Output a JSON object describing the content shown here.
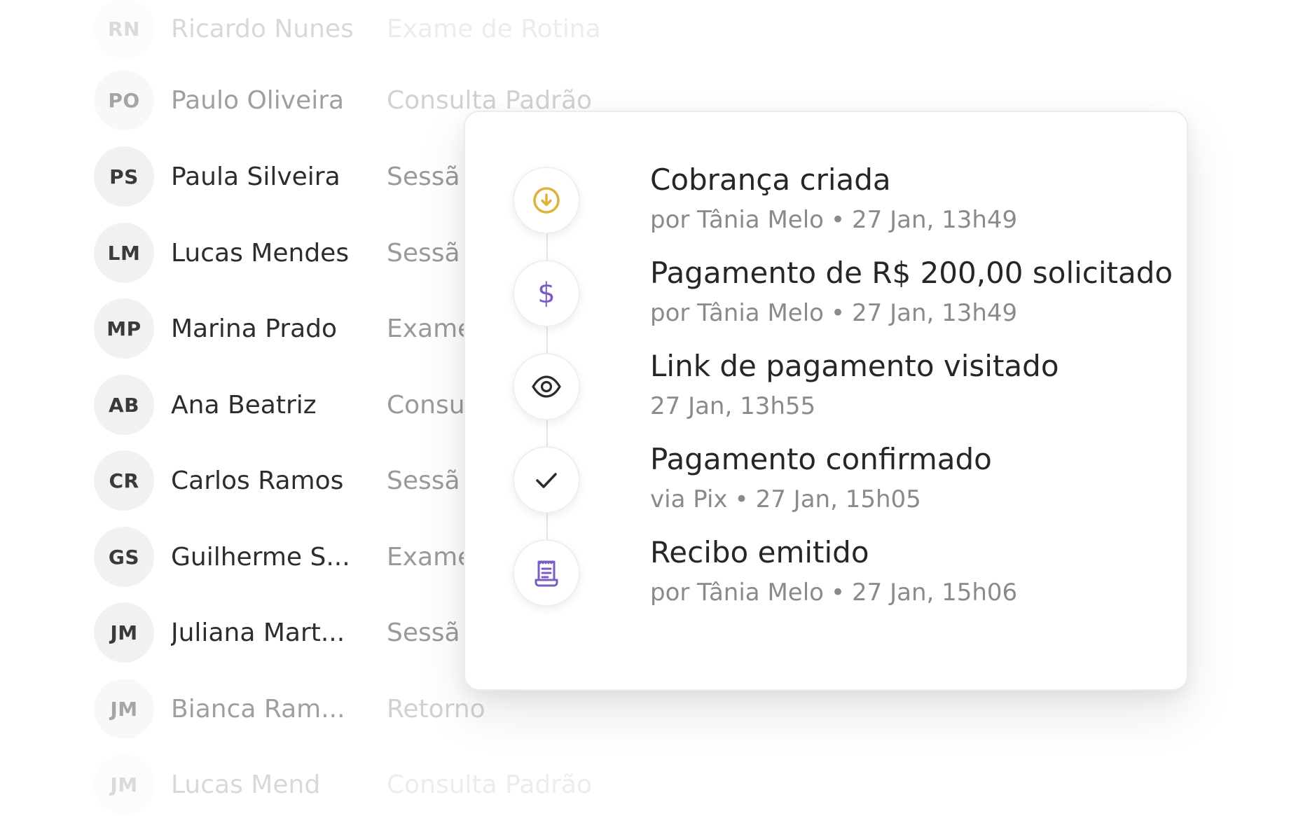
{
  "patients": [
    {
      "initials": "RN",
      "name": "Ricardo Nunes",
      "type": "Exame de Rotina"
    },
    {
      "initials": "PO",
      "name": "Paulo Oliveira",
      "type": "Consulta Padrão"
    },
    {
      "initials": "PS",
      "name": "Paula Silveira",
      "type": "Sessã"
    },
    {
      "initials": "LM",
      "name": "Lucas Mendes",
      "type": "Sessã"
    },
    {
      "initials": "MP",
      "name": "Marina Prado",
      "type": "Exame"
    },
    {
      "initials": "AB",
      "name": "Ana Beatriz",
      "type": "Consu"
    },
    {
      "initials": "CR",
      "name": "Carlos Ramos",
      "type": "Sessã"
    },
    {
      "initials": "GS",
      "name": "Guilherme S...",
      "type": "Exame"
    },
    {
      "initials": "JM",
      "name": "Juliana Mart...",
      "type": "Sessã"
    },
    {
      "initials": "JM",
      "name": "Bianca Ram...",
      "type": "Retorno"
    },
    {
      "initials": "JM",
      "name": "Lucas Mend",
      "type": "Consulta Padrão"
    }
  ],
  "timeline": {
    "events": [
      {
        "title": "Cobrança criada",
        "by": "por Tânia Melo",
        "time": "27 Jan, 13h49",
        "icon": "arrow-down-circle-icon",
        "color": "#e0b23a"
      },
      {
        "title": "Pagamento de R$ 200,00 solicitado",
        "by": "por Tânia Melo",
        "time": "27 Jan, 13h49",
        "icon": "dollar-icon",
        "color": "#7b5cc4"
      },
      {
        "title": "Link de pagamento visitado",
        "by": "",
        "time": "27 Jan, 13h55",
        "icon": "eye-icon",
        "color": "#2b2b2b"
      },
      {
        "title": "Pagamento confirmado",
        "by": "via Pix",
        "time": "27 Jan, 15h05",
        "icon": "check-icon",
        "color": "#2b2b2b"
      },
      {
        "title": "Recibo emitido",
        "by": "por Tânia Melo",
        "time": "27 Jan, 15h06",
        "icon": "receipt-icon",
        "color": "#7b5cc4"
      }
    ],
    "separator": "•"
  }
}
